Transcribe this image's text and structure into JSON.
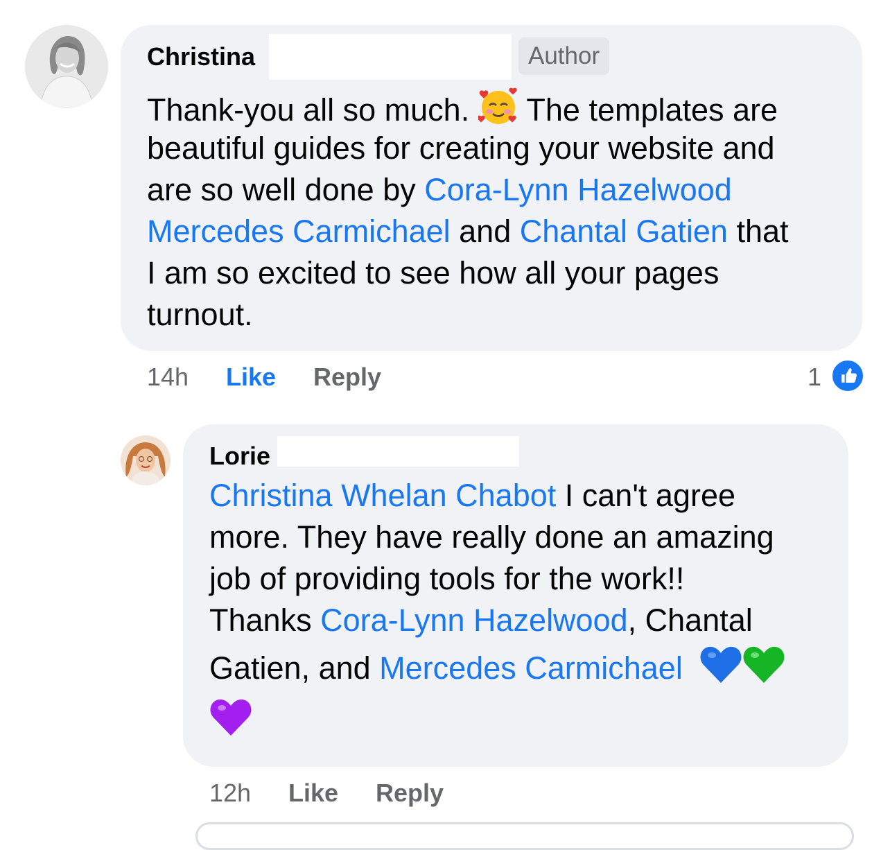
{
  "comments": [
    {
      "author": "Christina",
      "badge": "Author",
      "segments": {
        "l1a": "Thank-you all so much. ",
        "l1_emoji": "smiling-face-with-hearts",
        "l1b": " The templates are",
        "l2": "beautiful guides for creating your website and",
        "l3a": "are so well done by ",
        "l3m": "Cora-Lynn Hazelwood",
        "l4m1": "Mercedes Carmichael",
        "l4a": " and ",
        "l4m2": "Chantal Gatien",
        "l4b": " that",
        "l5": "I am so excited to see how all your pages",
        "l6": "turnout."
      },
      "time": "14h",
      "like_label": "Like",
      "reply_label": "Reply",
      "reaction_count": "1",
      "reaction_icon": "thumbs-up-icon"
    },
    {
      "author": "Lorie",
      "segments": {
        "l1m": "Christina Whelan Chabot",
        "l1a": " I can't agree",
        "l2": "more. They have really done an amazing",
        "l3": "job of providing tools for the work!!",
        "l4a": "Thanks ",
        "l4m": "Cora-Lynn Hazelwood",
        "l4b": ", Chantal",
        "l5a": "Gatien, and ",
        "l5m": "Mercedes Carmichael",
        "l5_emojis": [
          "blue-heart",
          "green-heart"
        ],
        "l6_emojis": [
          "purple-heart"
        ]
      },
      "time": "12h",
      "like_label": "Like",
      "reply_label": "Reply"
    }
  ],
  "colors": {
    "bubble": "#f0f2f5",
    "mention": "#1877f2",
    "meta": "#65676b",
    "badge_bg": "#e4e6eb"
  }
}
